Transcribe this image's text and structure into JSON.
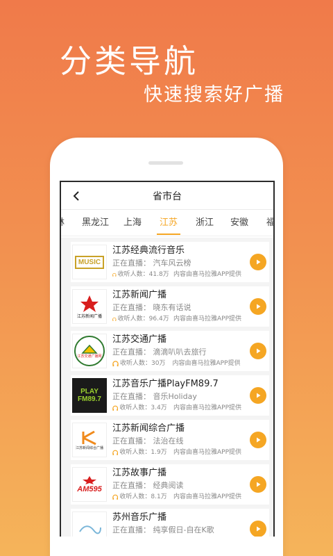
{
  "promo": {
    "headline": "分类导航",
    "subline": "快速搜索好广播"
  },
  "header": {
    "title": "省市台"
  },
  "tabs": [
    {
      "label": "林"
    },
    {
      "label": "黑龙江"
    },
    {
      "label": "上海"
    },
    {
      "label": "江苏",
      "active": true
    },
    {
      "label": "浙江"
    },
    {
      "label": "安徽"
    },
    {
      "label": "福"
    }
  ],
  "labels": {
    "listeners_prefix": "收听人数：",
    "provider": "内容由喜马拉雅APP提供"
  },
  "stations": [
    {
      "name": "江苏经典流行音乐",
      "live": "正在直播：  汽车风云榜",
      "listeners": "41.8万",
      "logo_text": "MUSIC"
    },
    {
      "name": "江苏新闻广播",
      "live": "正在直播：  晓东有话说",
      "listeners": "96.4万",
      "logo_text": "江苏新闻广播"
    },
    {
      "name": "江苏交通广播",
      "live": "正在直播：  滴滴叭叭去旅行",
      "listeners": "30万",
      "logo_text": "江苏交通广播网"
    },
    {
      "name": "江苏音乐广播PlayFM89.7",
      "live": "正在直播：  音乐Holiday",
      "listeners": "3.4万",
      "logo_text": "PLAY FM89.7"
    },
    {
      "name": "江苏新闻综合广播",
      "live": "正在直播：  法治在线",
      "listeners": "1.9万",
      "logo_text": "江苏新闻综合广播"
    },
    {
      "name": "江苏故事广播",
      "live": "正在直播：  经典阅读",
      "listeners": "8.1万",
      "logo_text": "AM595"
    },
    {
      "name": "苏州音乐广播",
      "live": "正在直播：  纯享假日-自在K歌",
      "listeners": "",
      "logo_text": ""
    }
  ],
  "colors": {
    "accent": "#f5a623",
    "bg_top": "#f07a4a",
    "bg_bottom": "#f5b45a"
  }
}
